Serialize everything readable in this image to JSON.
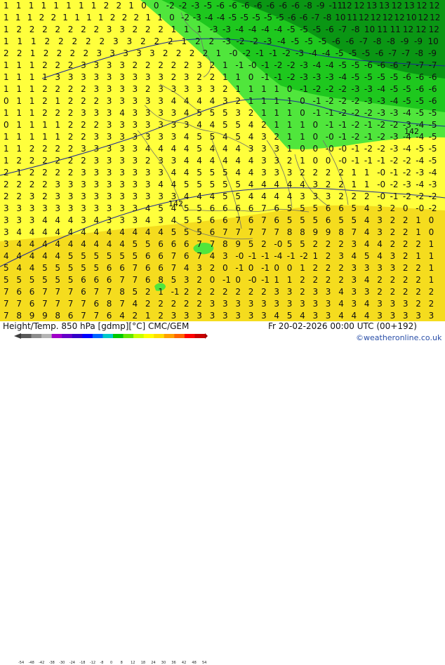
{
  "map": {
    "title": "Height/Temp. 850 hPa [gdmp][°C] CMC/GEM",
    "valid_time": "Fr 20-02-2026 00:00 UTC (00+192)",
    "credit": "©weatheronline.co.uk",
    "contour_label": "142",
    "colorbar": {
      "ticks": [
        "-54",
        "-48",
        "-42",
        "-38",
        "-30",
        "-24",
        "-18",
        "-12",
        "-8",
        "0",
        "8",
        "12",
        "18",
        "24",
        "30",
        "36",
        "42",
        "48",
        "54"
      ],
      "colors": [
        "#5a5a5a",
        "#8c8c8c",
        "#b4b4b4",
        "#a000c8",
        "#6400c8",
        "#3200c8",
        "#0000ff",
        "#0064ff",
        "#00c8c8",
        "#00c800",
        "#64e600",
        "#c8ff00",
        "#ffff00",
        "#ffdc00",
        "#ffa000",
        "#ff6400",
        "#ff0000",
        "#c80000"
      ]
    },
    "colors": {
      "yellow_light": "#ffff3c",
      "yellow_warm": "#f5dc1e",
      "green_light": "#50e63c",
      "green_mid": "#1ec81e",
      "green_dark": "#0a9614",
      "digits": "#111111",
      "border": "#6e6e6e",
      "contour": "#1e2896"
    },
    "rows": [
      "1 1 1 1 1 1 1 1 2 2 1 0 0 -2 -2 -3 -5 -6 -6 -6 -6 -6 -6 -6 -8 -9 -11 12 12 13 13 12 13 12 12",
      "1 1 1 2 2 1 1 1 1 2 2 2 1 1 0 -2 -3 -4 -4 -5 -5 -5 -5 -5 -6 -6 -7 -8 10 11 12 12 12 12 10 12 12",
      "1 2 2 2 2 2 2 2 3 3 2 2 2 1 1 1 -3 -3 -4 -4 -4 -4 -5 -5 -5 -6 -7 -8 10 11 11 12 12 12",
      "1 1 1 2 2 2 2 2 3 3 2 2 2 1 2 2 -3 -2 -2 -3 -4 -5 -5 -5 -6 -6 -7 -8 -8 -9 -9 10",
      "2 2 1 2 2 2 2 3 3 3 3 3 2 2 2 2 1 -0 -2 -1 -1 -2 -3 -4 -4 -5 -5 -5 -6 -7 -7 -8 -9",
      "1 1 1 2 2 2 3 3 3 3 2 2 2 2 2 3 2 1 -1 -0 -1 -2 -2 -3 -4 -4 -5 -5 -6 -6 -6 -7 -7 -7",
      "1 1 1 1 3 3 3 3 3 3 3 3 3 2 3 2 2 1 1 0 -1 -1 -2 -3 -3 -3 -4 -5 -5 -5 -5 -6 -6 -6",
      "1 1 1 2 2 2 2 3 3 3 3 2 3 3 3 3 3 2 1 1 1 1 0 -1 -2 -2 -2 -3 -3 -4 -5 -5 -6 -6",
      "0 1 1 2 1 2 2 2 3 3 3 3 3 4 4 4 4 3 2 1 1 1 1 0 -1 -2 -2 -2 -3 -3 -4 -5 -5 -6",
      "1 1 1 2 2 2 3 3 3 4 3 3 3 3 4 5 5 5 3 2 1 1 1 0 -1 -1 -2 -2 -2 -3 -3 -4 -5 -5",
      "0 1 1 1 1 2 2 2 3 3 3 3 3 3 3 4 4 5 5 4 2 1 1 1 0 -1 -1 -2 -1 -2 -2 -3 -4 -5",
      "1 1 1 1 1 2 2 3 3 3 3 3 3 3 4 5 5 4 5 4 3 2 1 1 0 -0 -1 -2 -1 -2 -3 -4 -4 -5",
      "1 1 2 2 2 2 3 3 3 3 3 4 4 4 4 5 4 4 4 3 3 3 1 0 0 -0 -0 -1 -2 -2 -3 -4 -5 -5",
      "1 2 2 2 2 2 2 3 3 3 3 2 3 3 4 4 4 4 4 4 3 3 2 1 0 0 -0 -1 -1 -1 -2 -2 -4 -5",
      "2 1 2 2 2 2 3 3 3 3 3 3 3 4 4 5 5 5 4 4 3 3 3 2 2 2 2 1 1 -0 -1 -2 -3 -4",
      "2 2 2 2 3 3 3 3 3 3 3 3 4 4 5 5 5 5 5 4 4 4 4 4 3 2 2 1 1 -0 -2 -3 -4 -3",
      "2 2 3 2 3 3 3 3 3 3 3 3 3 3 4 4 4 5 5 4 4 4 4 3 3 3 2 2 2 -0 -1 -2 -2 -2",
      "3 3 3 3 3 3 3 3 3 3 3 4 5 4 5 5 6 6 6 6 7 6 5 5 5 6 6 5 4 3 2 0 -0 -2",
      "3 3 3 4 4 4 3 4 3 3 3 4 3 4 5 5 6 6 7 6 7 6 5 5 5 6 5 5 4 3 2 2 1 0",
      "3 4 4 4 4 4 4 4 4 4 4 4 4 5 5 5 6 7 7 7 7 7 8 8 9 9 8 7 4 3 2 2 1 0",
      "3 4 4 4 4 4 4 4 4 4 5 5 6 6 6 7 7 8 9 5 2 -0 5 5 2 2 2 3 4 4 2 2 2 1",
      "4 4 4 4 4 5 5 5 5 5 5 6 6 7 6 7 4 3 -0 -1 -1 -4 -1 -2 1 2 3 4 5 4 3 2 1 1",
      "5 4 4 5 5 5 5 5 6 6 7 6 6 7 4 3 2 0 -1 0 -1 0 0 1 2 2 2 3 3 3 3 2 2 1",
      "5 5 5 5 5 5 6 6 6 7 7 6 8 5 3 2 0 -1 0 -0 -1 1 1 2 2 2 2 3 4 2 2 2 2 1",
      "7 6 6 7 7 7 6 7 7 8 5 2 1 -1 2 2 2 2 2 2 2 3 3 2 3 3 4 3 3 2 2 2 2 2",
      "7 7 6 7 7 7 7 6 8 7 4 2 2 2 2 2 3 3 3 3 3 3 3 3 3 3 4 3 4 3 3 3 2 2",
      "7 8 9 9 8 6 7 7 6 4 2 1 2 3 3 3 3 3 3 3 3 4 5 4 3 3 4 4 4 3 3 3 3 3"
    ]
  }
}
